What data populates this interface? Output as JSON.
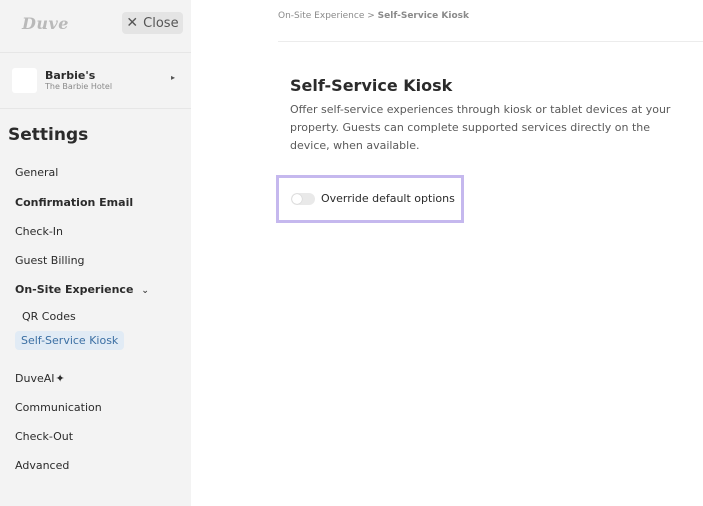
{
  "sidebar": {
    "logo": "Duve",
    "close_label": "Close",
    "property": {
      "name": "Barbie's",
      "subtitle": "The Barbie Hotel"
    },
    "settings_title": "Settings",
    "nav": [
      {
        "label": "General"
      },
      {
        "label": "Confirmation Email"
      },
      {
        "label": "Check-In"
      },
      {
        "label": "Guest Billing"
      },
      {
        "label": "On-Site Experience",
        "expanded": true,
        "children": [
          {
            "label": "QR Codes"
          },
          {
            "label": "Self-Service Kiosk",
            "active": true
          }
        ]
      },
      {
        "label": "DuveAI"
      },
      {
        "label": "Communication"
      },
      {
        "label": "Check-Out"
      },
      {
        "label": "Advanced"
      }
    ]
  },
  "breadcrumb": {
    "parent": "On-Site Experience",
    "separator": ">",
    "current": "Self-Service Kiosk"
  },
  "main": {
    "title": "Self-Service Kiosk",
    "description": "Offer self-service experiences through kiosk or tablet devices at your property. Guests can complete supported services directly on the device, when available.",
    "override": {
      "label": "Override default options",
      "enabled": false
    }
  },
  "colors": {
    "sidebar_bg": "#f3f3f3",
    "active_item_bg": "#e1ebf5",
    "active_item_text": "#3b6fa3",
    "highlight_border": "#c5b8ee"
  }
}
